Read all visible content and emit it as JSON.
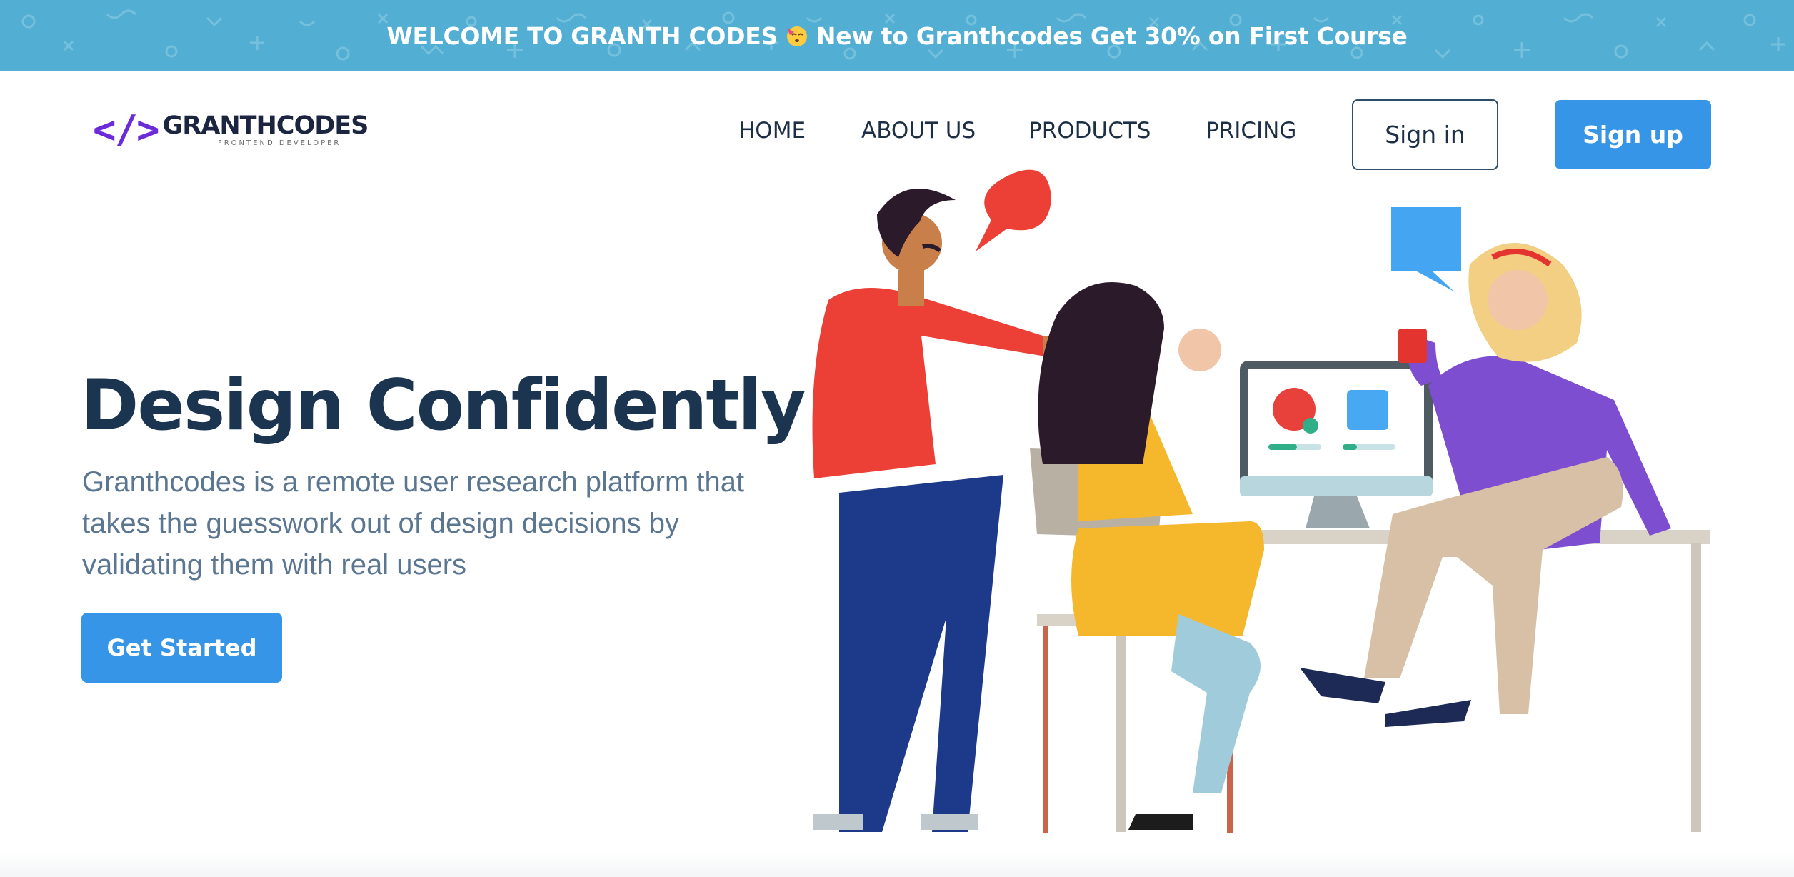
{
  "announcement": {
    "text_before": "WELCOME TO GRANTH CODES",
    "emoji": "party-face",
    "text_after": "New to Granthcodes Get 30% on First Course",
    "background": "#52afd3"
  },
  "logo": {
    "mark": "</>",
    "name": "GRANTHCODES",
    "tagline": "FRONTEND DEVELOPER",
    "mark_color": "#6c2bd9"
  },
  "nav": {
    "items": [
      {
        "label": "HOME"
      },
      {
        "label": "ABOUT US"
      },
      {
        "label": "PRODUCTS"
      },
      {
        "label": "PRICING"
      }
    ],
    "signin_label": "Sign in",
    "signup_label": "Sign up"
  },
  "hero": {
    "title": "Design Confidently",
    "description": "Granthcodes is a remote user research platform that takes the guesswork out of design decisions by validating them with real users",
    "cta_label": "Get Started"
  },
  "colors": {
    "primary": "#3695e6",
    "heading": "#1b3450",
    "body_text": "#5b7691"
  },
  "illustration": {
    "icon": "team-collaboration-illustration"
  }
}
